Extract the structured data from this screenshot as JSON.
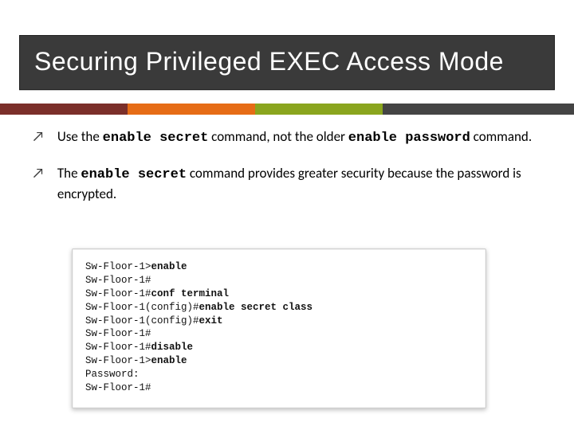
{
  "title": "Securing Privileged EXEC Access Mode",
  "bullets": [
    {
      "pre": "Use the ",
      "code1": "enable secret",
      "mid": " command, not the older ",
      "code2": "enable password",
      "post": " command."
    },
    {
      "pre": "The ",
      "code1": "enable secret",
      "mid": " command provides greater security because the password is encrypted.",
      "code2": "",
      "post": ""
    }
  ],
  "terminal_lines": [
    {
      "prompt": "Sw-Floor-1>",
      "cmd": "enable"
    },
    {
      "prompt": "Sw-Floor-1#",
      "cmd": ""
    },
    {
      "prompt": "Sw-Floor-1#",
      "cmd": "conf terminal"
    },
    {
      "prompt": "Sw-Floor-1(config)#",
      "cmd": "enable secret class"
    },
    {
      "prompt": "Sw-Floor-1(config)#",
      "cmd": "exit"
    },
    {
      "prompt": "Sw-Floor-1#",
      "cmd": ""
    },
    {
      "prompt": "Sw-Floor-1#",
      "cmd": "disable"
    },
    {
      "prompt": "Sw-Floor-1>",
      "cmd": "enable"
    },
    {
      "prompt": "Password:",
      "cmd": ""
    },
    {
      "prompt": "Sw-Floor-1#",
      "cmd": ""
    }
  ]
}
